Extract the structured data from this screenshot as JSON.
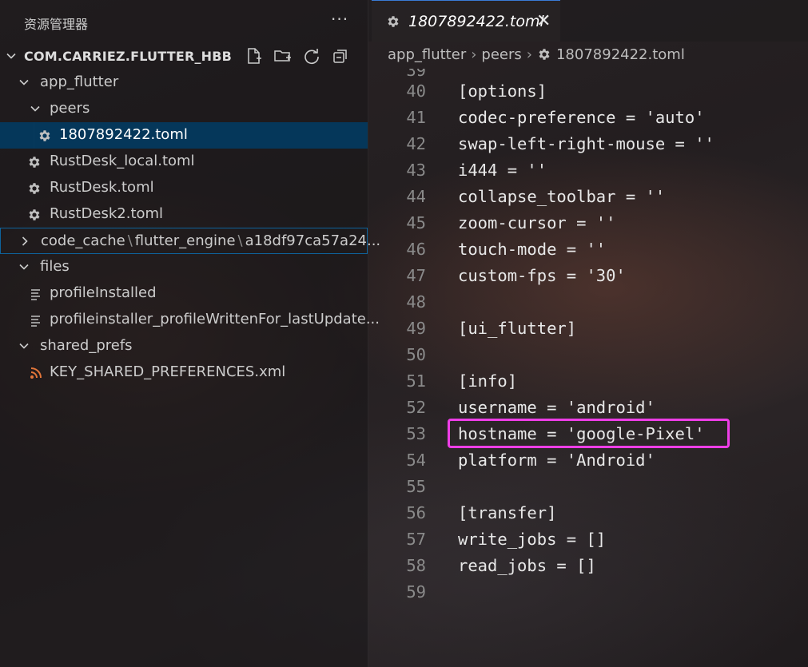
{
  "sidebar": {
    "title": "资源管理器",
    "more_label": "···",
    "root": {
      "label": "COM.CARRIEZ.FLUTTER_HBB"
    },
    "tree": [
      {
        "kind": "folder",
        "label": "app_flutter",
        "expanded": true
      },
      {
        "kind": "folder",
        "label": "peers",
        "expanded": true
      },
      {
        "kind": "file",
        "icon": "gear-icon",
        "label": "1807892422.toml",
        "selected": true
      },
      {
        "kind": "file",
        "icon": "gear-icon",
        "label": "RustDesk_local.toml"
      },
      {
        "kind": "file",
        "icon": "gear-icon",
        "label": "RustDesk.toml"
      },
      {
        "kind": "file",
        "icon": "gear-icon",
        "label": "RustDesk2.toml"
      },
      {
        "kind": "folder",
        "expanded": false,
        "segments": [
          "code_cache",
          "flutter_engine",
          "a18df97ca57a24..."
        ]
      },
      {
        "kind": "folder",
        "label": "files",
        "expanded": true
      },
      {
        "kind": "file",
        "icon": "text-file-icon",
        "label": "profileInstalled"
      },
      {
        "kind": "file",
        "icon": "text-file-icon",
        "label": "profileinstaller_profileWrittenFor_lastUpdate..."
      },
      {
        "kind": "folder",
        "label": "shared_prefs",
        "expanded": true
      },
      {
        "kind": "file",
        "icon": "rss-icon",
        "label": "KEY_SHARED_PREFERENCES.xml"
      }
    ],
    "path_separator": "\\"
  },
  "editor": {
    "tab": {
      "label": "1807892422.toml",
      "close_label": "✕"
    },
    "breadcrumb": [
      "app_flutter",
      "peers",
      "1807892422.toml"
    ],
    "breadcrumb_separator": "›",
    "partial_line_number": "39",
    "lines": [
      {
        "n": "40",
        "text": "[options]"
      },
      {
        "n": "41",
        "text": "codec-preference = 'auto'"
      },
      {
        "n": "42",
        "text": "swap-left-right-mouse = ''"
      },
      {
        "n": "43",
        "text": "i444 = ''"
      },
      {
        "n": "44",
        "text": "collapse_toolbar = ''"
      },
      {
        "n": "45",
        "text": "zoom-cursor = ''"
      },
      {
        "n": "46",
        "text": "touch-mode = ''"
      },
      {
        "n": "47",
        "text": "custom-fps = '30'"
      },
      {
        "n": "48",
        "text": ""
      },
      {
        "n": "49",
        "text": "[ui_flutter]"
      },
      {
        "n": "50",
        "text": ""
      },
      {
        "n": "51",
        "text": "[info]"
      },
      {
        "n": "52",
        "text": "username = 'android'"
      },
      {
        "n": "53",
        "text": "hostname = 'google-Pixel'"
      },
      {
        "n": "54",
        "text": "platform = 'Android'"
      },
      {
        "n": "55",
        "text": ""
      },
      {
        "n": "56",
        "text": "[transfer]"
      },
      {
        "n": "57",
        "text": "write_jobs = []"
      },
      {
        "n": "58",
        "text": "read_jobs = []"
      },
      {
        "n": "59",
        "text": ""
      }
    ]
  },
  "colors": {
    "selection": "#04395e",
    "highlight_box": "#ee3ee7",
    "gear_icon": "#c0c0c0",
    "rss_icon": "#e2763a"
  }
}
